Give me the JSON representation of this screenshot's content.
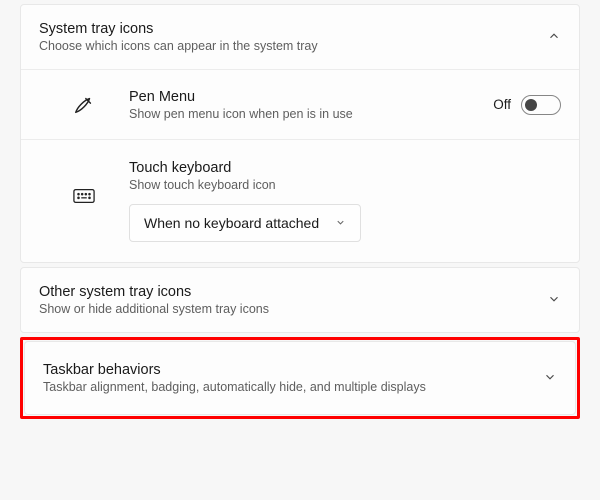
{
  "sections": {
    "systemTray": {
      "title": "System tray icons",
      "subtitle": "Choose which icons can appear in the system tray",
      "expanded": true,
      "rows": {
        "penMenu": {
          "title": "Pen Menu",
          "subtitle": "Show pen menu icon when pen is in use",
          "stateLabel": "Off",
          "toggled": false,
          "icon": "pen-icon"
        },
        "touchKeyboard": {
          "title": "Touch keyboard",
          "subtitle": "Show touch keyboard icon",
          "icon": "keyboard-icon",
          "selectValue": "When no keyboard attached"
        }
      }
    },
    "otherTray": {
      "title": "Other system tray icons",
      "subtitle": "Show or hide additional system tray icons",
      "expanded": false
    },
    "taskbarBehaviors": {
      "title": "Taskbar behaviors",
      "subtitle": "Taskbar alignment, badging, automatically hide, and multiple displays",
      "expanded": false,
      "highlighted": true
    }
  }
}
